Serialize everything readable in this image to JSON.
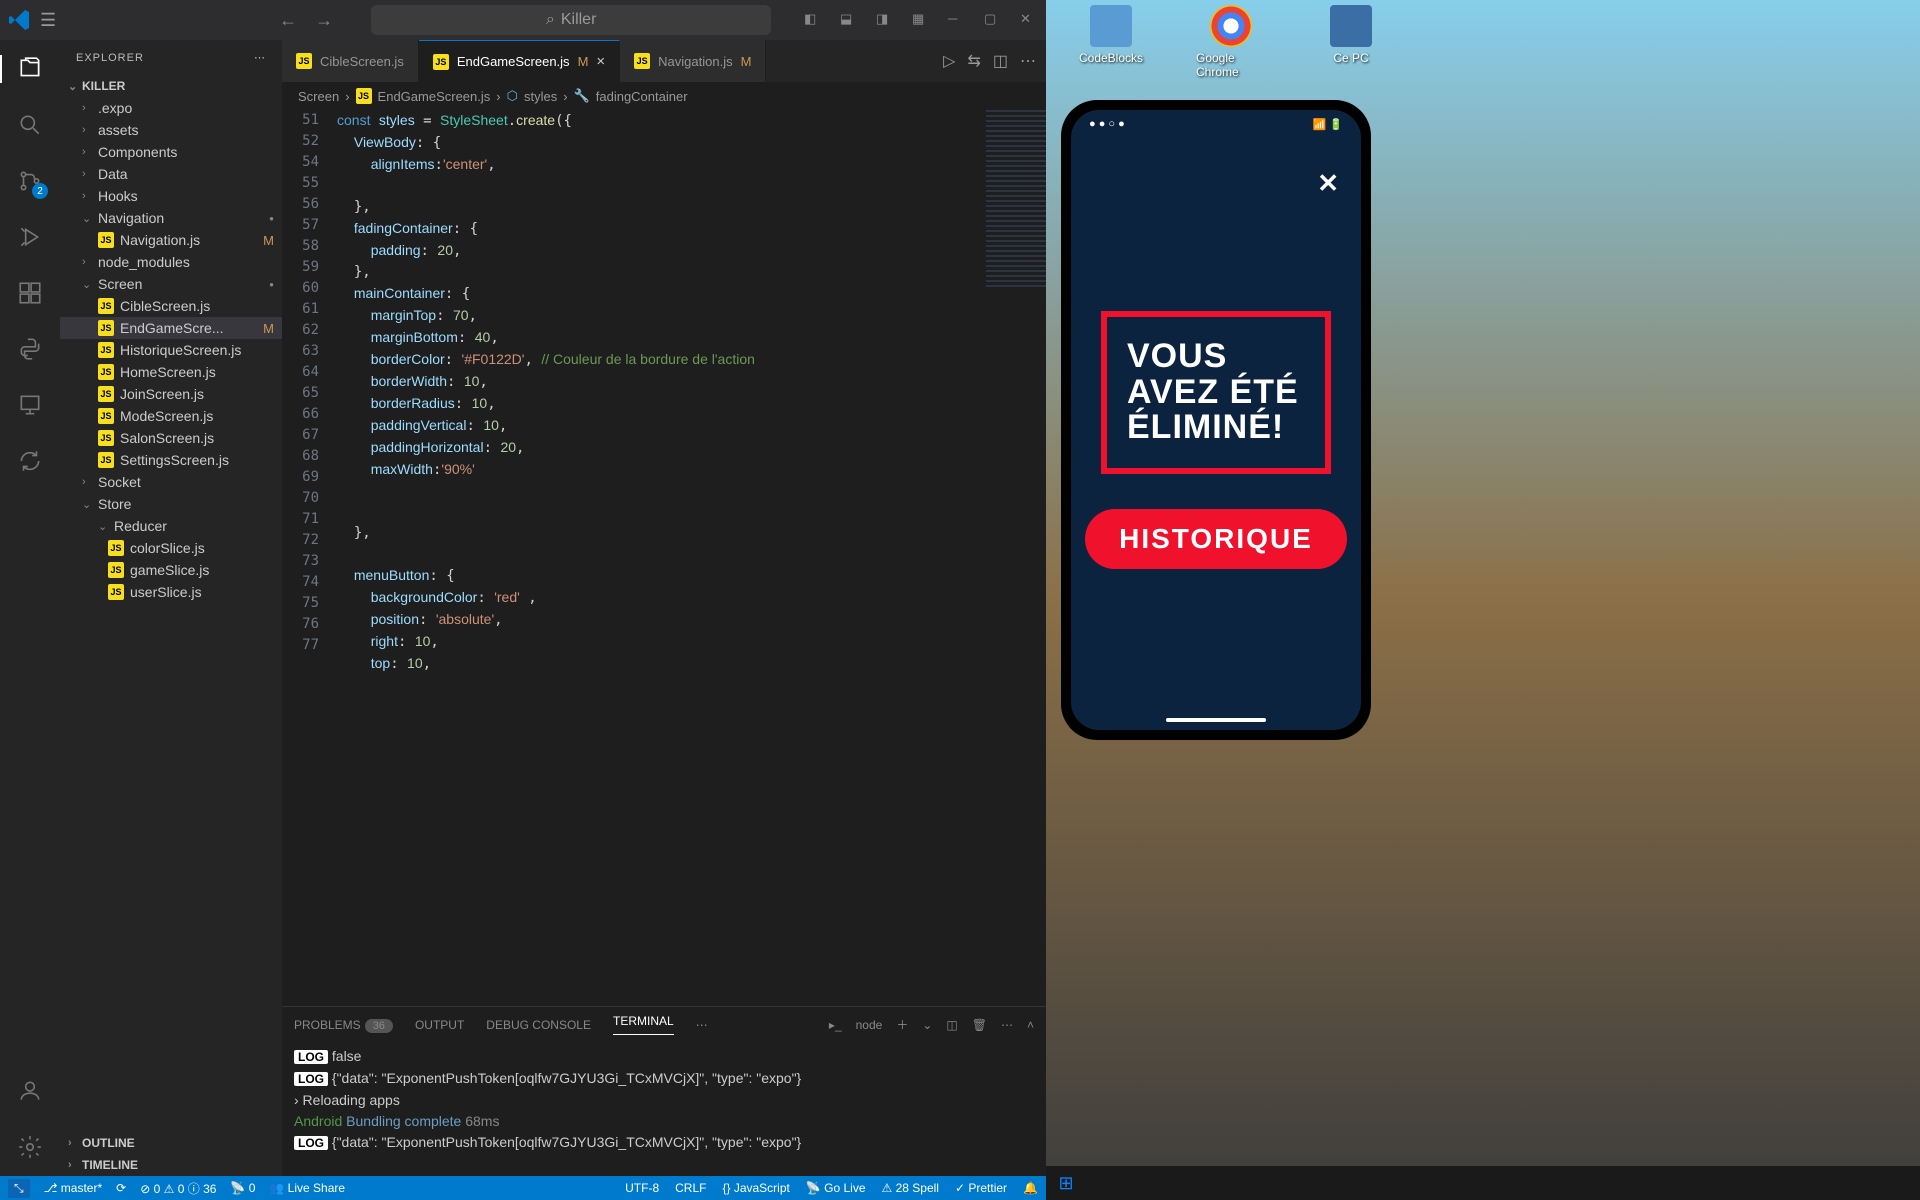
{
  "titlebar": {
    "search_text": "Killer"
  },
  "explorer": {
    "title": "EXPLORER",
    "project": "KILLER",
    "folders": [
      ".expo",
      "assets",
      "Components",
      "Data",
      "Hooks"
    ],
    "nav_folder": "Navigation",
    "nav_file": "Navigation.js",
    "nav_mod": "M",
    "node_modules": "node_modules",
    "screen_folder": "Screen",
    "screen_files": [
      "CibleScreen.js",
      "EndGameScre...",
      "HistoriqueScreen.js",
      "HomeScreen.js",
      "JoinScreen.js",
      "ModeScreen.js",
      "SalonScreen.js",
      "SettingsScreen.js"
    ],
    "socket": "Socket",
    "store": "Store",
    "reducer": "Reducer",
    "reducer_files": [
      "colorSlice.js",
      "gameSlice.js",
      "userSlice.js"
    ],
    "outline": "OUTLINE",
    "timeline": "TIMELINE"
  },
  "tabs": [
    {
      "label": "CibleScreen.js",
      "modified": ""
    },
    {
      "label": "EndGameScreen.js",
      "modified": "M"
    },
    {
      "label": "Navigation.js",
      "modified": "M"
    }
  ],
  "breadcrumb": {
    "part1": "Screen",
    "part2": "EndGameScreen.js",
    "part3": "styles",
    "part4": "fadingContainer"
  },
  "code_lines": [
    {
      "num": 51,
      "html": "<span class='kw'>const</span> <span class='var'>styles</span> = <span class='cls'>StyleSheet</span>.<span class='fn'>create</span>({"
    },
    {
      "num": 52,
      "html": "  <span class='var'>ViewBody</span>: {"
    },
    {
      "num": 54,
      "html": "    <span class='var'>alignItems</span>:<span class='str'>'center'</span>,"
    },
    {
      "num": 55,
      "html": ""
    },
    {
      "num": 56,
      "html": "  },"
    },
    {
      "num": 57,
      "html": "  <span class='var'>fadingContainer</span>: {"
    },
    {
      "num": 58,
      "html": "    <span class='var'>padding</span>: <span class='num'>20</span>,"
    },
    {
      "num": 59,
      "html": "  },"
    },
    {
      "num": 60,
      "html": "  <span class='var'>mainContainer</span>: {"
    },
    {
      "num": 61,
      "html": "    <span class='var'>marginTop</span>: <span class='num'>70</span>,"
    },
    {
      "num": 62,
      "html": "    <span class='var'>marginBottom</span>: <span class='num'>40</span>,"
    },
    {
      "num": 63,
      "html": "    <span class='var'>borderColor</span>: <span class='str'>'#F0122D'</span>, <span class='cmt'>// Couleur de la bordure de l'action</span>"
    },
    {
      "num": 64,
      "html": "    <span class='var'>borderWidth</span>: <span class='num'>10</span>,"
    },
    {
      "num": 65,
      "html": "    <span class='var'>borderRadius</span>: <span class='num'>10</span>,"
    },
    {
      "num": 66,
      "html": "    <span class='var'>paddingVertical</span>: <span class='num'>10</span>,"
    },
    {
      "num": 67,
      "html": "    <span class='var'>paddingHorizontal</span>: <span class='num'>20</span>,"
    },
    {
      "num": 68,
      "html": "    <span class='var'>maxWidth</span>:<span class='str'>'90%'</span>"
    },
    {
      "num": 69,
      "html": ""
    },
    {
      "num": 70,
      "html": ""
    },
    {
      "num": 71,
      "html": "  },"
    },
    {
      "num": 72,
      "html": ""
    },
    {
      "num": 73,
      "html": "  <span class='var'>menuButton</span>: {"
    },
    {
      "num": 74,
      "html": "    <span class='var'>backgroundColor</span>: <span class='str'>'red'</span> ,"
    },
    {
      "num": 75,
      "html": "    <span class='var'>position</span>: <span class='str'>'absolute'</span>,"
    },
    {
      "num": 76,
      "html": "    <span class='var'>right</span>: <span class='num'>10</span>,"
    },
    {
      "num": 77,
      "html": "    <span class='var'>top</span>: <span class='num'>10</span>,"
    }
  ],
  "panel": {
    "problems": "PROBLEMS",
    "problems_count": "36",
    "output": "OUTPUT",
    "debug": "DEBUG CONSOLE",
    "terminal": "TERMINAL",
    "shell": "node",
    "line1_tag": "LOG",
    "line1": " false",
    "line2_tag": "LOG",
    "line2": " {\"data\": \"ExponentPushToken[oqlfw7GJYU3Gi_TCxMVCjX]\", \"type\": \"expo\"}",
    "line3": "› Reloading apps",
    "line4_a": "Android ",
    "line4_b": "Bundling complete ",
    "line4_c": "68ms",
    "line5_tag": "LOG",
    "line5": " {\"data\": \"ExponentPushToken[oqlfw7GJYU3Gi_TCxMVCjX]\", \"type\": \"expo\"}"
  },
  "status": {
    "branch": "master*",
    "errors": "0",
    "warnings": "0",
    "info": "36",
    "port": "0",
    "liveshare": "Live Share",
    "encoding": "UTF-8",
    "eol": "CRLF",
    "lang": "JavaScript",
    "golive": "Go Live",
    "spell": "28 Spell",
    "prettier": "Prettier"
  },
  "desktop": {
    "codeblocks": "CodeBlocks",
    "chrome": "Google Chrome",
    "thispc": "Ce PC"
  },
  "phone": {
    "message": "Vous avez été éliminé!",
    "button": "HISTORIQUE"
  }
}
